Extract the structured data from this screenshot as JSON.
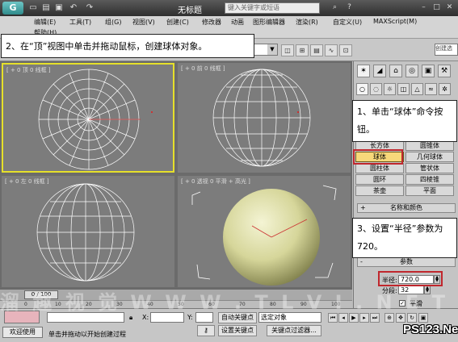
{
  "titlebar": {
    "logo": "G",
    "title": "无标题",
    "search_placeholder": "键入关键字或短语",
    "quick_icons": [
      "new-file-icon",
      "open-file-icon",
      "save-icon",
      "undo-icon",
      "redo-icon"
    ]
  },
  "menu": {
    "items": [
      "编辑(E)",
      "工具(T)",
      "组(G)",
      "视图(V)",
      "创建(C)",
      "修改器",
      "动画",
      "图形编辑器",
      "渲染(R)",
      "自定义(U)",
      "MAXScript(M)",
      "帮助(H)"
    ]
  },
  "toolbar": {
    "right_input": "创建选"
  },
  "viewports": {
    "top": "[ + 0 顶 0 线框 ]",
    "front": "[ + 0 前 0 线框 ]",
    "left": "[ + 0 左 0 线框 ]",
    "perspective": "[ + 0 透视 0 平滑 + 高光 ]"
  },
  "command_panel": {
    "primitive_buttons": [
      "长方体",
      "圆锥体",
      "球体",
      "几何球体",
      "圆柱体",
      "管状体",
      "圆环",
      "四棱锥",
      "茶壶",
      "平面"
    ],
    "rollout_name_color": "名称和颜色",
    "rollout_params": "参数",
    "radius_label": "半径:",
    "radius_value": "720.0",
    "segments_label": "分段:",
    "segments_value": "32",
    "smooth_label": "平滑",
    "smooth_checked": true
  },
  "callouts": {
    "step1": "2、在“顶”视图中单击并拖动鼠标，创建球体对象。",
    "step2": "1、单击“球体”命令按钮。",
    "step3": "3、设置“半径”参数为 720。"
  },
  "timeline": {
    "frame": "0 / 100",
    "ruler_ticks": [
      "0",
      "10",
      "20",
      "30",
      "40",
      "50",
      "60",
      "70",
      "80",
      "90",
      "100"
    ]
  },
  "statusbar": {
    "welcome": "欢迎使用",
    "prompt": "单击并拖动以开始创建过程",
    "x_label": "X:",
    "y_label": "Y:",
    "autokey": "自动关键点",
    "selected_object": "选定对象",
    "set_key": "设置关键点",
    "key_filters": "关键点过滤器..."
  },
  "watermark": "溜 趣 视 觉  W W W . T L V I . N E T",
  "brand": {
    "text": "PS123.Net"
  },
  "colors": {
    "viewport_bg": "#7c7c7c",
    "active_border": "#e6e02a",
    "callout_border": "#c0272d",
    "sphere_shaded": "#dcdca2"
  }
}
